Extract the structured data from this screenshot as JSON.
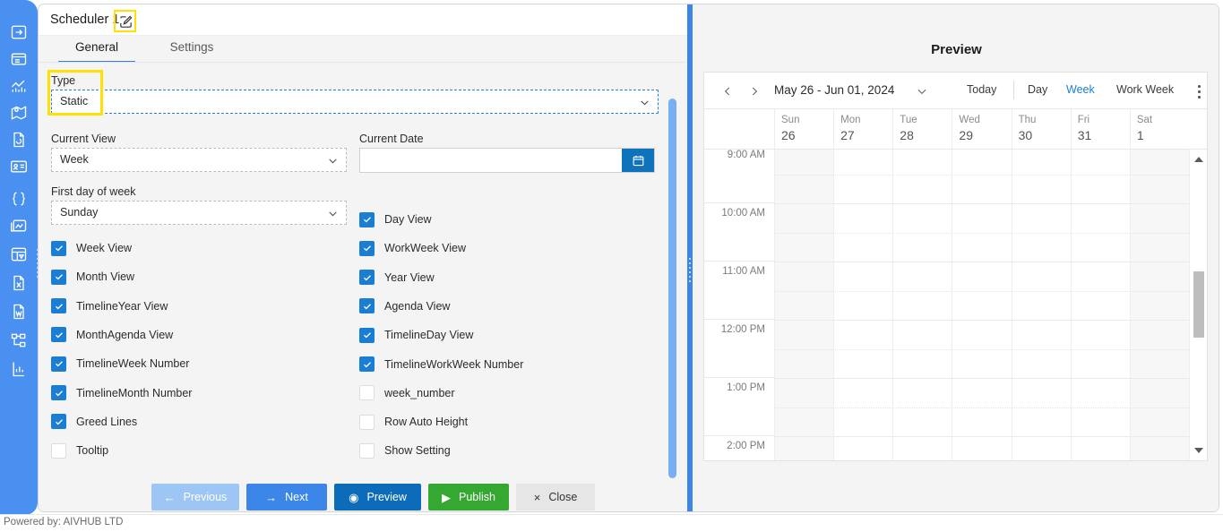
{
  "app": {
    "powered_by": "Powered by: AIVHUB LTD"
  },
  "window": {
    "title": "Scheduler 1",
    "edit_icon": "edit-pencil-icon",
    "help_label": "?",
    "close_label": "×"
  },
  "rail": {
    "items": [
      {
        "name": "export-arrow-icon"
      },
      {
        "name": "panel-layout-icon"
      },
      {
        "name": "chart-analytics-icon"
      },
      {
        "name": "map-pin-icon"
      },
      {
        "name": "document-refresh-icon"
      },
      {
        "name": "id-card-icon"
      },
      {
        "name": "code-braces-icon"
      },
      {
        "name": "image-chart-icon"
      },
      {
        "name": "dashboard-widget-icon"
      },
      {
        "name": "excel-file-icon"
      },
      {
        "name": "word-file-icon"
      },
      {
        "name": "hierarchy-tree-icon"
      },
      {
        "name": "bar-chart-icon"
      }
    ]
  },
  "tabs": [
    {
      "id": "general",
      "label": "General",
      "active": true
    },
    {
      "id": "settings",
      "label": "Settings",
      "active": false
    }
  ],
  "form": {
    "type": {
      "label": "Type",
      "value": "Static",
      "highlighted": true
    },
    "current_view": {
      "label": "Current View",
      "value": "Week"
    },
    "current_date": {
      "label": "Current Date",
      "value": "",
      "placeholder": "",
      "button_icon": "calendar-icon"
    },
    "first_day_of_week": {
      "label": "First day of week",
      "value": "Sunday"
    },
    "checkboxes_left": [
      {
        "label": "Week View",
        "checked": true
      },
      {
        "label": "Month View",
        "checked": true
      },
      {
        "label": "TimelineYear View",
        "checked": true
      },
      {
        "label": "MonthAgenda View",
        "checked": true
      },
      {
        "label": "TimelineWeek Number",
        "checked": true
      },
      {
        "label": "TimelineMonth Number",
        "checked": true
      },
      {
        "label": "Greed Lines",
        "checked": true
      },
      {
        "label": "Tooltip",
        "checked": false
      }
    ],
    "checkboxes_right": [
      {
        "label": "Day View",
        "checked": true
      },
      {
        "label": "WorkWeek View",
        "checked": true
      },
      {
        "label": "Year View",
        "checked": true
      },
      {
        "label": "Agenda View",
        "checked": true
      },
      {
        "label": "TimelineDay View",
        "checked": true
      },
      {
        "label": "TimelineWorkWeek Number",
        "checked": true
      },
      {
        "label": "week_number",
        "checked": false
      },
      {
        "label": "Row Auto Height",
        "checked": false
      },
      {
        "label": "Show Setting",
        "checked": false
      }
    ]
  },
  "footer_buttons": [
    {
      "id": "previous",
      "label": "Previous",
      "glyph": "←",
      "color": "#9dc6f5"
    },
    {
      "id": "next",
      "label": "Next",
      "glyph": "→",
      "color": "#3b86e8"
    },
    {
      "id": "preview",
      "label": "Preview",
      "glyph": "◉",
      "color": "#0c6cb9"
    },
    {
      "id": "publish",
      "label": "Publish",
      "glyph": "▶",
      "color": "#34a831"
    },
    {
      "id": "close",
      "label": "Close",
      "glyph": "×",
      "color": "#e6e6e6"
    }
  ],
  "preview": {
    "title": "Preview",
    "calendar": {
      "range_label": "May 26 - Jun 01, 2024",
      "today_label": "Today",
      "views": [
        {
          "label": "Day",
          "selected": false
        },
        {
          "label": "Week",
          "selected": true
        },
        {
          "label": "Work Week",
          "selected": false
        }
      ],
      "accent_color": "#1a7fd4",
      "days": [
        {
          "dow": "Sun",
          "num": "26",
          "weekend": true
        },
        {
          "dow": "Mon",
          "num": "27",
          "weekend": false
        },
        {
          "dow": "Tue",
          "num": "28",
          "weekend": false
        },
        {
          "dow": "Wed",
          "num": "29",
          "weekend": false
        },
        {
          "dow": "Thu",
          "num": "30",
          "weekend": false
        },
        {
          "dow": "Fri",
          "num": "31",
          "weekend": false
        },
        {
          "dow": "Sat",
          "num": "1",
          "weekend": true
        }
      ],
      "time_slots": [
        "9:00 AM",
        "10:00 AM",
        "11:00 AM",
        "12:00 PM",
        "1:00 PM",
        "2:00 PM"
      ],
      "events": []
    }
  }
}
